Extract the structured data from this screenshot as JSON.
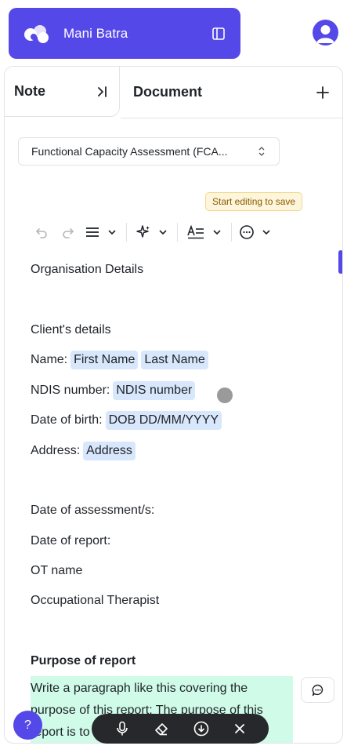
{
  "header": {
    "user_name": "Mani Batra",
    "colors": {
      "brand": "#5548e8"
    }
  },
  "tabs": {
    "note": {
      "label": "Note"
    },
    "document": {
      "label": "Document"
    }
  },
  "template_selector": {
    "value": "Functional Capacity Assessment (FCA..."
  },
  "save_hint": "Start editing to save",
  "document": {
    "org_details": "Organisation Details",
    "client_details": "Client's details",
    "name_label": "Name:",
    "name_first": "First Name",
    "name_last": "Last Name",
    "ndis_label": "NDIS number:",
    "ndis_value": "NDIS number",
    "dob_label": "Date of birth:",
    "dob_value": "DOB DD/MM/YYYY",
    "address_label": "Address:",
    "address_value": "Address",
    "date_assessment": "Date of assessment/s:",
    "date_report": "Date of report:",
    "ot_name": "OT name",
    "ot_title": "Occupational Therapist",
    "purpose_heading": "Purpose of report",
    "purpose_text": "Write a paragraph like this covering the purpose of this report: The purpose of this report is to"
  },
  "help_label": "?"
}
